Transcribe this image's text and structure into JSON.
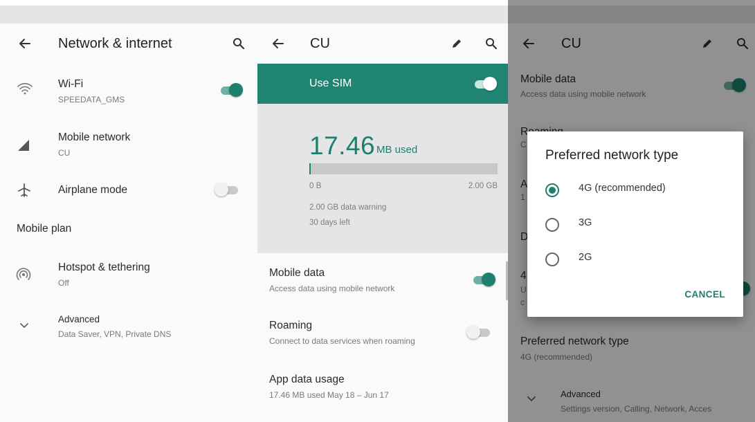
{
  "colors": {
    "accent": "#1b806f",
    "sim_bar": "#1f8572"
  },
  "network": {
    "title": "Network & internet",
    "items": [
      {
        "title": "Wi-Fi",
        "subtitle": "SPEEDATA_GMS",
        "icon": "wifi-icon",
        "toggle": "on"
      },
      {
        "title": "Mobile network",
        "subtitle": "CU",
        "icon": "cellular-signal-icon"
      },
      {
        "title": "Airplane mode",
        "icon": "airplane-icon",
        "toggle": "off"
      }
    ],
    "section_header": "Mobile plan",
    "hotspot": {
      "title": "Hotspot & tethering",
      "subtitle": "Off",
      "icon": "hotspot-icon"
    },
    "advanced": {
      "title": "Advanced",
      "subtitle": "Data Saver, VPN, Private DNS",
      "icon": "chevron-down-icon"
    }
  },
  "sim": {
    "title": "CU",
    "use_sim_label": "Use SIM",
    "use_sim_on": true,
    "usage_value": "17.46",
    "usage_unit": "MB used",
    "usage_fraction": 0.0085,
    "range_min": "0 B",
    "range_max": "2.00 GB",
    "warning": "2.00 GB data warning",
    "days_left": "30 days left",
    "mobile_data": {
      "title": "Mobile data",
      "subtitle": "Access data using mobile network",
      "on": true
    },
    "roaming": {
      "title": "Roaming",
      "subtitle": "Connect to data services when roaming",
      "on": false
    },
    "app_usage": {
      "title": "App data usage",
      "subtitle": "17.46 MB used May 18 – Jun 17"
    }
  },
  "dialog_screen": {
    "title": "CU",
    "mobile_data": {
      "title": "Mobile data",
      "subtitle": "Access data using mobile network"
    },
    "partial_roaming_title": "Roaming",
    "partial_roaming_sub": "C",
    "partial_a": "A",
    "partial_a_sub": "1",
    "partial_d": "D",
    "partial_4": "4",
    "partial_u": "U",
    "partial_c": "c",
    "preferred": {
      "title": "Preferred network type",
      "subtitle": "4G (recommended)"
    },
    "advanced": {
      "title": "Advanced",
      "subtitle": "Settings version, Calling, Network, Acces"
    },
    "dialog": {
      "title": "Preferred network type",
      "options": [
        "4G (recommended)",
        "3G",
        "2G"
      ],
      "selected": 0,
      "cancel": "CANCEL"
    }
  }
}
